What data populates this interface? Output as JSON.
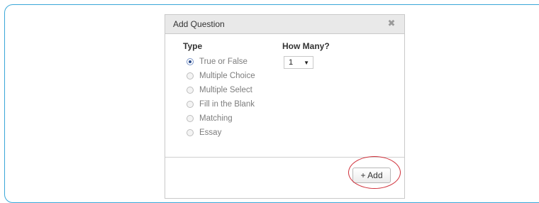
{
  "dialog": {
    "title": "Add Question",
    "close_icon": "close-icon",
    "type_label": "Type",
    "how_many_label": "How Many?",
    "types": [
      {
        "label": "True or False",
        "checked": true
      },
      {
        "label": "Multiple Choice",
        "checked": false
      },
      {
        "label": "Multiple Select",
        "checked": false
      },
      {
        "label": "Fill in the Blank",
        "checked": false
      },
      {
        "label": "Matching",
        "checked": false
      },
      {
        "label": "Essay",
        "checked": false
      }
    ],
    "how_many_value": "1",
    "add_button_label": "+ Add"
  },
  "colors": {
    "frame_border": "#3aa7d8",
    "highlight_ring": "#d0303a",
    "selected_radio": "#2b4c8c"
  }
}
